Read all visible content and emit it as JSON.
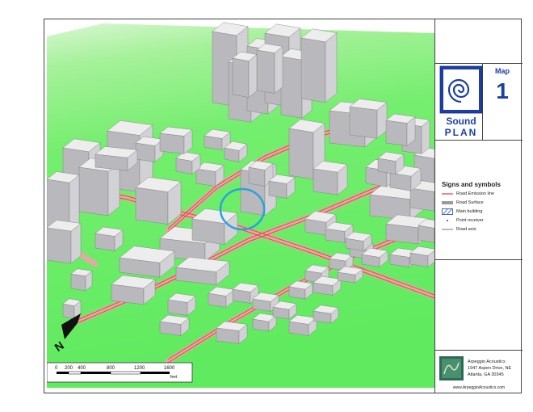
{
  "map": {
    "label": "Map",
    "number": "1"
  },
  "logo": {
    "line1": "Sound",
    "line2": "PLAN"
  },
  "legend": {
    "title": "Signs and symbols",
    "items": [
      {
        "label": "Road Emission line",
        "symbol": "red-line"
      },
      {
        "label": "Road Surface",
        "symbol": "gray-band"
      },
      {
        "label": "Main building",
        "symbol": "hatched-box"
      },
      {
        "label": "Point receiver",
        "symbol": "dot"
      },
      {
        "label": "Road axis",
        "symbol": "gray-line"
      }
    ]
  },
  "company": {
    "name": "Arpeggio Acoustics",
    "address1": "1947 Aspen Drive, NE",
    "address2": "Atlanta, GA 30345",
    "url": "www.ArpeggioAcoustics.com"
  },
  "scale": {
    "ticks": [
      "0",
      "200",
      "400",
      "800",
      "1200",
      "1600"
    ],
    "unit": "feet"
  },
  "north": {
    "letter": "N"
  },
  "colors": {
    "ground_light": "#c9f3c0",
    "ground_green": "#66ee66",
    "road_surface": "#e8a8a8",
    "road_line": "#e0403a",
    "building_top": "#ededed",
    "building_side": "#b9b9bd",
    "highlight_ring": "#2aa3d8",
    "brand_blue": "#1b3fa7"
  }
}
